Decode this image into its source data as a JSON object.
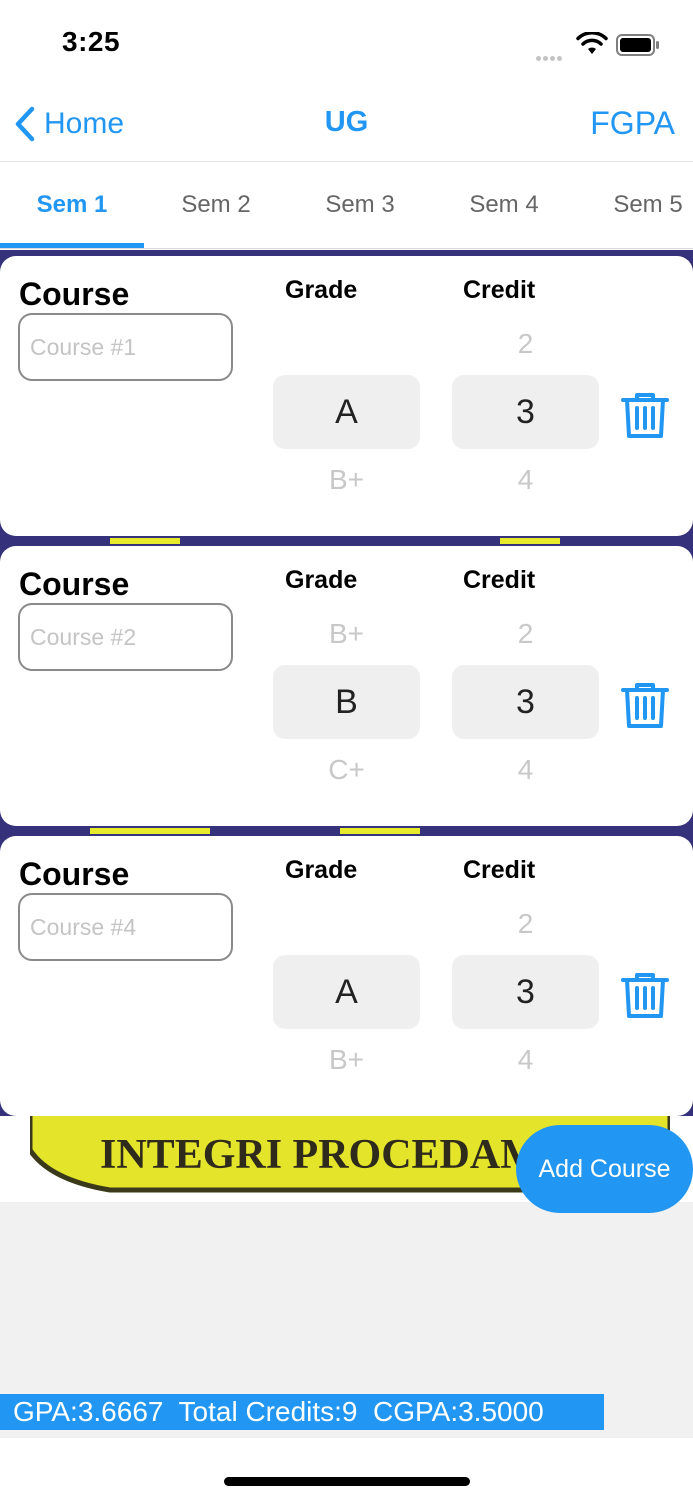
{
  "status_bar": {
    "time": "3:25"
  },
  "nav": {
    "back_label": "Home",
    "title": "UG",
    "right_label": "FGPA"
  },
  "tabs": [
    {
      "label": "Sem 1",
      "active": true
    },
    {
      "label": "Sem 2",
      "active": false
    },
    {
      "label": "Sem 3",
      "active": false
    },
    {
      "label": "Sem 4",
      "active": false
    },
    {
      "label": "Sem 5",
      "active": false
    }
  ],
  "courses": [
    {
      "course_label": "Course",
      "course_placeholder": "Course #1",
      "grade_header": "Grade",
      "credit_header": "Credit",
      "grade_above": "",
      "grade_selected": "A",
      "grade_below": "B+",
      "credit_above": "2",
      "credit_selected": "3",
      "credit_below": "4"
    },
    {
      "course_label": "Course",
      "course_placeholder": "Course #2",
      "grade_header": "Grade",
      "credit_header": "Credit",
      "grade_above": "B+",
      "grade_selected": "B",
      "grade_below": "C+",
      "credit_above": "2",
      "credit_selected": "3",
      "credit_below": "4"
    },
    {
      "course_label": "Course",
      "course_placeholder": "Course #4",
      "grade_header": "Grade",
      "credit_header": "Credit",
      "grade_above": "",
      "grade_selected": "A",
      "grade_below": "B+",
      "credit_above": "2",
      "credit_selected": "3",
      "credit_below": "4"
    }
  ],
  "background_logo_text": "INTEGRI PROCEDAM",
  "add_course_label": "Add Course",
  "summary": {
    "text": "GPA:3.6667  Total Credits:9  CGPA:3.5000"
  },
  "colors": {
    "accent": "#2196f3",
    "card": "#ffffff",
    "picker": "#efefef",
    "background": "#f1f1f1"
  }
}
